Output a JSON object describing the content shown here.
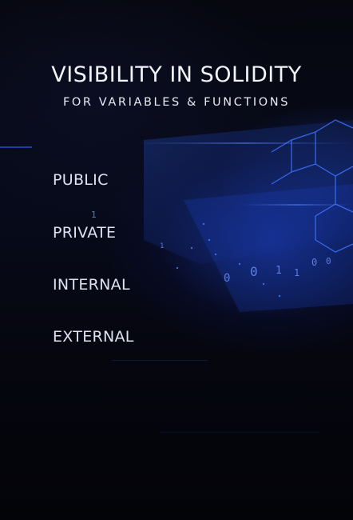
{
  "title": "VISIBILITY IN SOLIDITY",
  "subtitle": "FOR VARIABLES & FUNCTIONS",
  "items": [
    {
      "label": "PUBLIC"
    },
    {
      "label": "PRIVATE"
    },
    {
      "label": "INTERNAL"
    },
    {
      "label": "EXTERNAL"
    }
  ],
  "background": {
    "digits": [
      "1",
      "0",
      "0",
      "1",
      "1",
      "0",
      "0",
      "1"
    ],
    "accent_color": "#1f4fe0"
  }
}
